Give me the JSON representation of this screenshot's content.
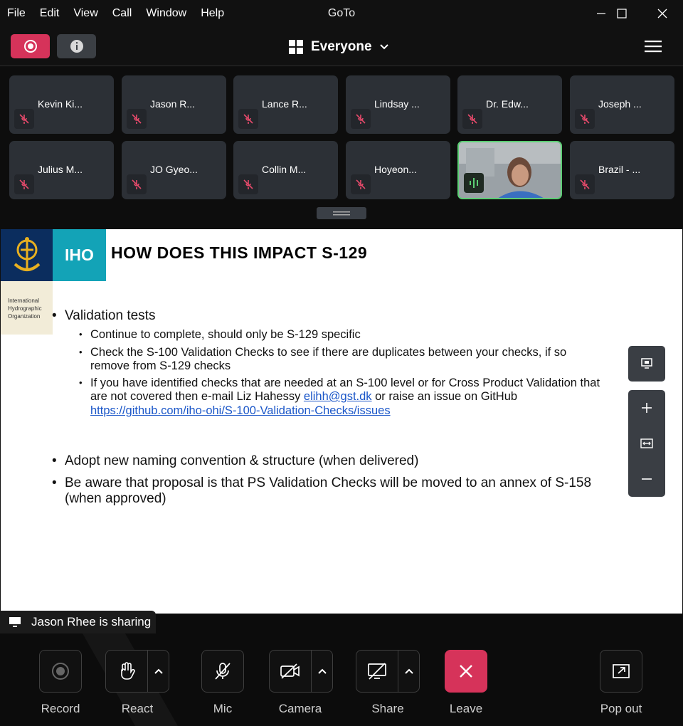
{
  "menu": [
    "File",
    "Edit",
    "View",
    "Call",
    "Window",
    "Help"
  ],
  "app_title": "GoTo",
  "toolbar": {
    "view_label": "Everyone"
  },
  "participants": [
    "Kevin Ki...",
    "Jason R...",
    "Lance R...",
    "Lindsay ...",
    "Dr. Edw...",
    "Joseph ...",
    "Julius M...",
    "JO Gyeo...",
    "Collin M...",
    "Hoyeon...",
    "",
    "Brazil - ..."
  ],
  "slide": {
    "logo_text": "IHO",
    "org_text": [
      "International",
      "Hydrographic",
      "Organization"
    ],
    "title": "HOW DOES THIS IMPACT S-129",
    "bullet1": "Validation tests",
    "sub1": "Continue to complete, should only be S-129 specific",
    "sub2_l1": "Check the S-100 Validation Checks to see if there are duplicates between your checks, if so",
    "sub2_l2": "remove from S-129 checks",
    "sub3_l1": "If you have identified checks that are needed at an S-100 level or for Cross Product Validation that",
    "sub3_l2a": "are not covered then e-mail Liz Hahessy ",
    "sub3_email": "elihh@gst.dk",
    "sub3_l2b": " or raise an issue on GitHub",
    "sub3_url": "https://github.com/iho-ohi/S-100-Validation-Checks/issues",
    "bullet2": "Adopt new naming convention & structure (when delivered)",
    "bullet3_l1": "Be aware that proposal is that PS Validation Checks will be moved to an annex of S-158",
    "bullet3_l2": "(when approved)"
  },
  "share_banner": "Jason Rhee is sharing",
  "controls": {
    "record": "Record",
    "react": "React",
    "mic": "Mic",
    "camera": "Camera",
    "share": "Share",
    "leave": "Leave",
    "popout": "Pop out"
  },
  "colors": {
    "record_red": "#d6335a",
    "iho_teal": "#13a3b7",
    "navy": "#0b2d5e",
    "speaking_green": "#5ccf74"
  }
}
